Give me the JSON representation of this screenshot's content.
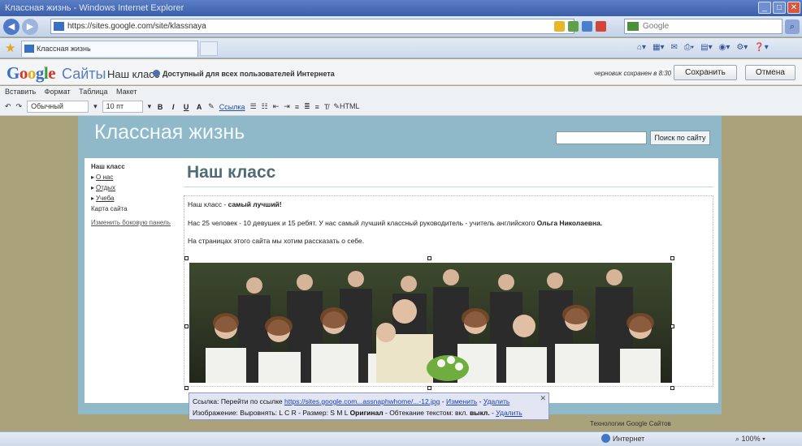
{
  "window": {
    "title": "Классная жизнь - Windows Internet Explorer"
  },
  "browser": {
    "url": "https://sites.google.com/site/klassnaya",
    "search_placeholder": "Google",
    "tab_title": "Классная жизнь"
  },
  "gsites": {
    "logo_letters": [
      "G",
      "o",
      "o",
      "g",
      "l",
      "e"
    ],
    "sites_word": "Сайты",
    "page_name": "Наш класс",
    "visibility": "Доступный для всех пользователей Интернета",
    "draft_note": "черновик сохранен в 8:30",
    "save_label": "Сохранить",
    "cancel_label": "Отмена"
  },
  "editor": {
    "menus": [
      "Вставить",
      "Формат",
      "Таблица",
      "Макет"
    ],
    "style_select": "Обычный",
    "size_select": "10 пт",
    "bold": "B",
    "italic": "I",
    "underline": "U",
    "text_color": "A",
    "link_label": "Ссылка",
    "html_label": "HTML"
  },
  "site": {
    "title": "Классная жизнь",
    "search_button": "Поиск по сайту",
    "nav": [
      {
        "label": "Наш класс",
        "current": true,
        "arrow": false
      },
      {
        "label": "О нас",
        "current": false,
        "arrow": true
      },
      {
        "label": "Отдых",
        "current": false,
        "arrow": true
      },
      {
        "label": "Учеба",
        "current": false,
        "arrow": true
      },
      {
        "label": "Карта сайта",
        "current": false,
        "arrow": false
      }
    ],
    "edit_nav": "Изменить боковую панель",
    "heading": "Наш класс",
    "para1_start": "Наш класс - ",
    "para1_bold": "самый лучший!",
    "para2_start": "Нас 25 человек - 10 девушек и 15 ребят. У нас самый лучший классный руководитель - учитель английского ",
    "para2_bold": "Ольга Николаевна.",
    "para3": "На страницах этого сайта мы хотим рассказать о себе.",
    "footer_tech": "Технологии Google Сайтов"
  },
  "link_popup": {
    "row1_prefix": "Ссылка: Перейти по ссылке ",
    "row1_link": "https://sites.google.com...assnaphwhome/...-12.jpg",
    "row1_change": "Изменить",
    "row1_remove": "Удалить",
    "row2_image": "Изображение:",
    "row2_align": "Выровнять: L C R",
    "row2_size": "Размер: S M L",
    "row2_original": "Оригинал",
    "row2_wrap": "Обтекание текстом: вкл.",
    "row2_off": "выкл.",
    "row2_remove": "Удалить"
  },
  "status": {
    "zone": "Интернет",
    "zoom": "100%"
  },
  "colors": {
    "site_header": "#8fb9c9",
    "page_background": "#a9a27a",
    "heading": "#4d6b78"
  }
}
